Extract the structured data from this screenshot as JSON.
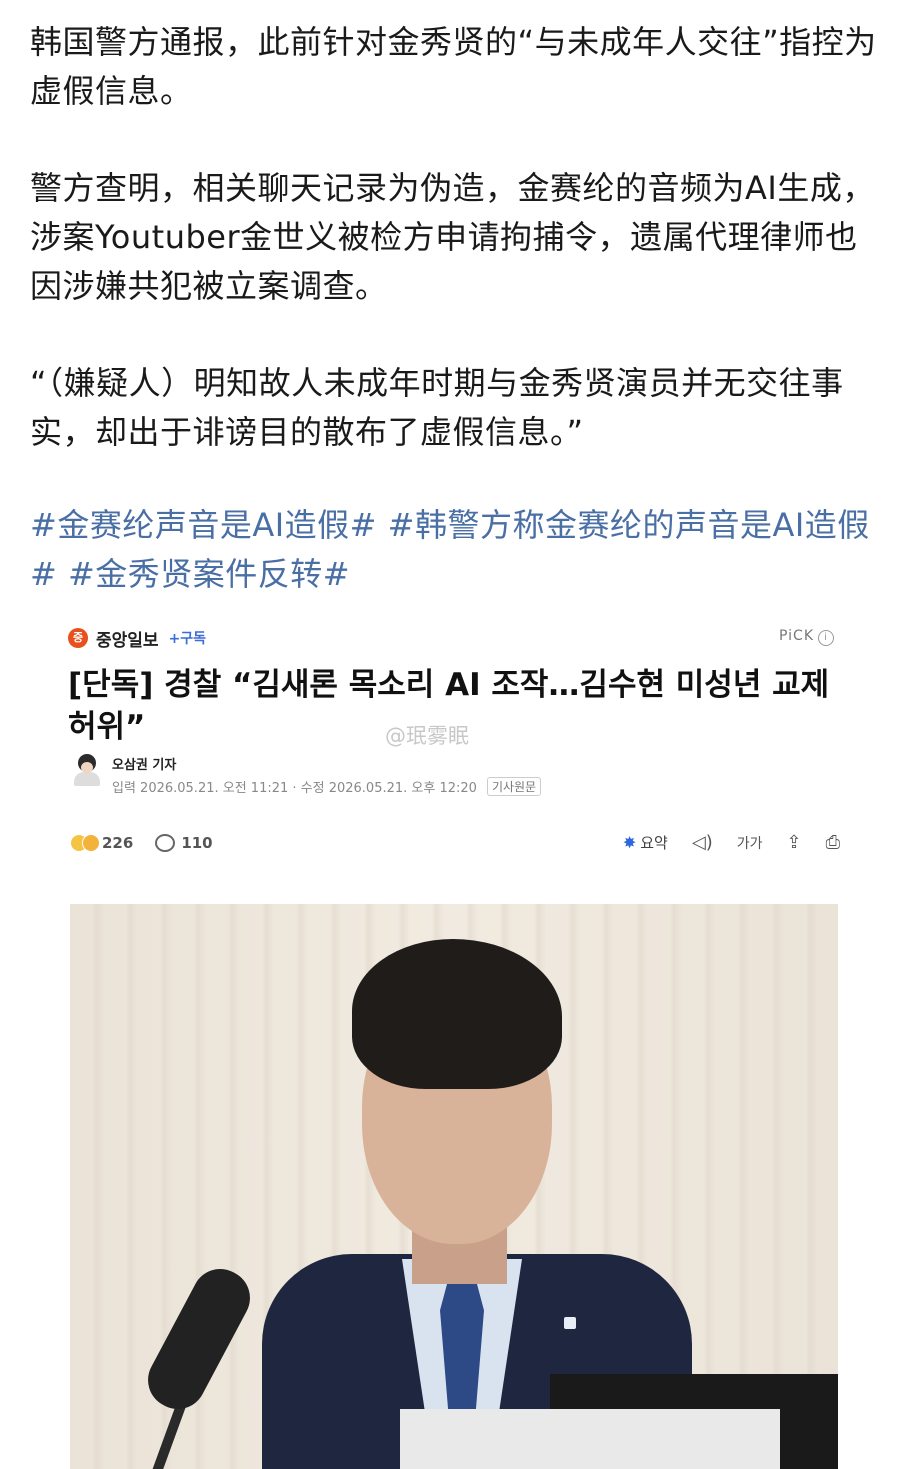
{
  "post": {
    "paragraphs": [
      "韩国警方通报，此前针对金秀贤的“与未成年人交往”指控为虚假信息。",
      "警方查明，相关聊天记录为伪造，金赛纶的音频为AI生成，涉案Youtuber金世义被检方申请拘捕令，遗属代理律师也因涉嫌共犯被立案调查。",
      "“（嫌疑人）明知故人未成年时期与金秀贤演员并无交往事实，却出于诽谤目的散布了虚假信息。”"
    ],
    "hashtags": [
      "#金赛纶声音是AI造假#",
      "#韩警方称金赛纶的声音是AI造假#",
      "#金秀贤案件反转#"
    ],
    "colors": {
      "hashtag": "#4a6fa5",
      "text": "#1a1a1a"
    }
  },
  "embed": {
    "source_name": "중앙일보",
    "source_logo_text": "중",
    "subscribe": "+구독",
    "pick": "PiCK",
    "pick_info_icon": "i",
    "headline": "[단독] 경찰 “김새론 목소리 AI 조작…김수현 미성년 교제 허위”",
    "watermark": "@珉雾眠",
    "author": "오삼권 기자",
    "dates": "입력 2026.05.21. 오전 11:21 · 수정 2026.05.21. 오후 12:20",
    "original_button": "기사원문",
    "reactions_count": "226",
    "comments_count": "110",
    "summary_label": "요약",
    "summary_icon": "✸",
    "audio_icon": "◁)",
    "font_size_label": "가가",
    "share_icon": "⇪",
    "print_icon": "⎙",
    "photo_description_icon": "photo"
  }
}
